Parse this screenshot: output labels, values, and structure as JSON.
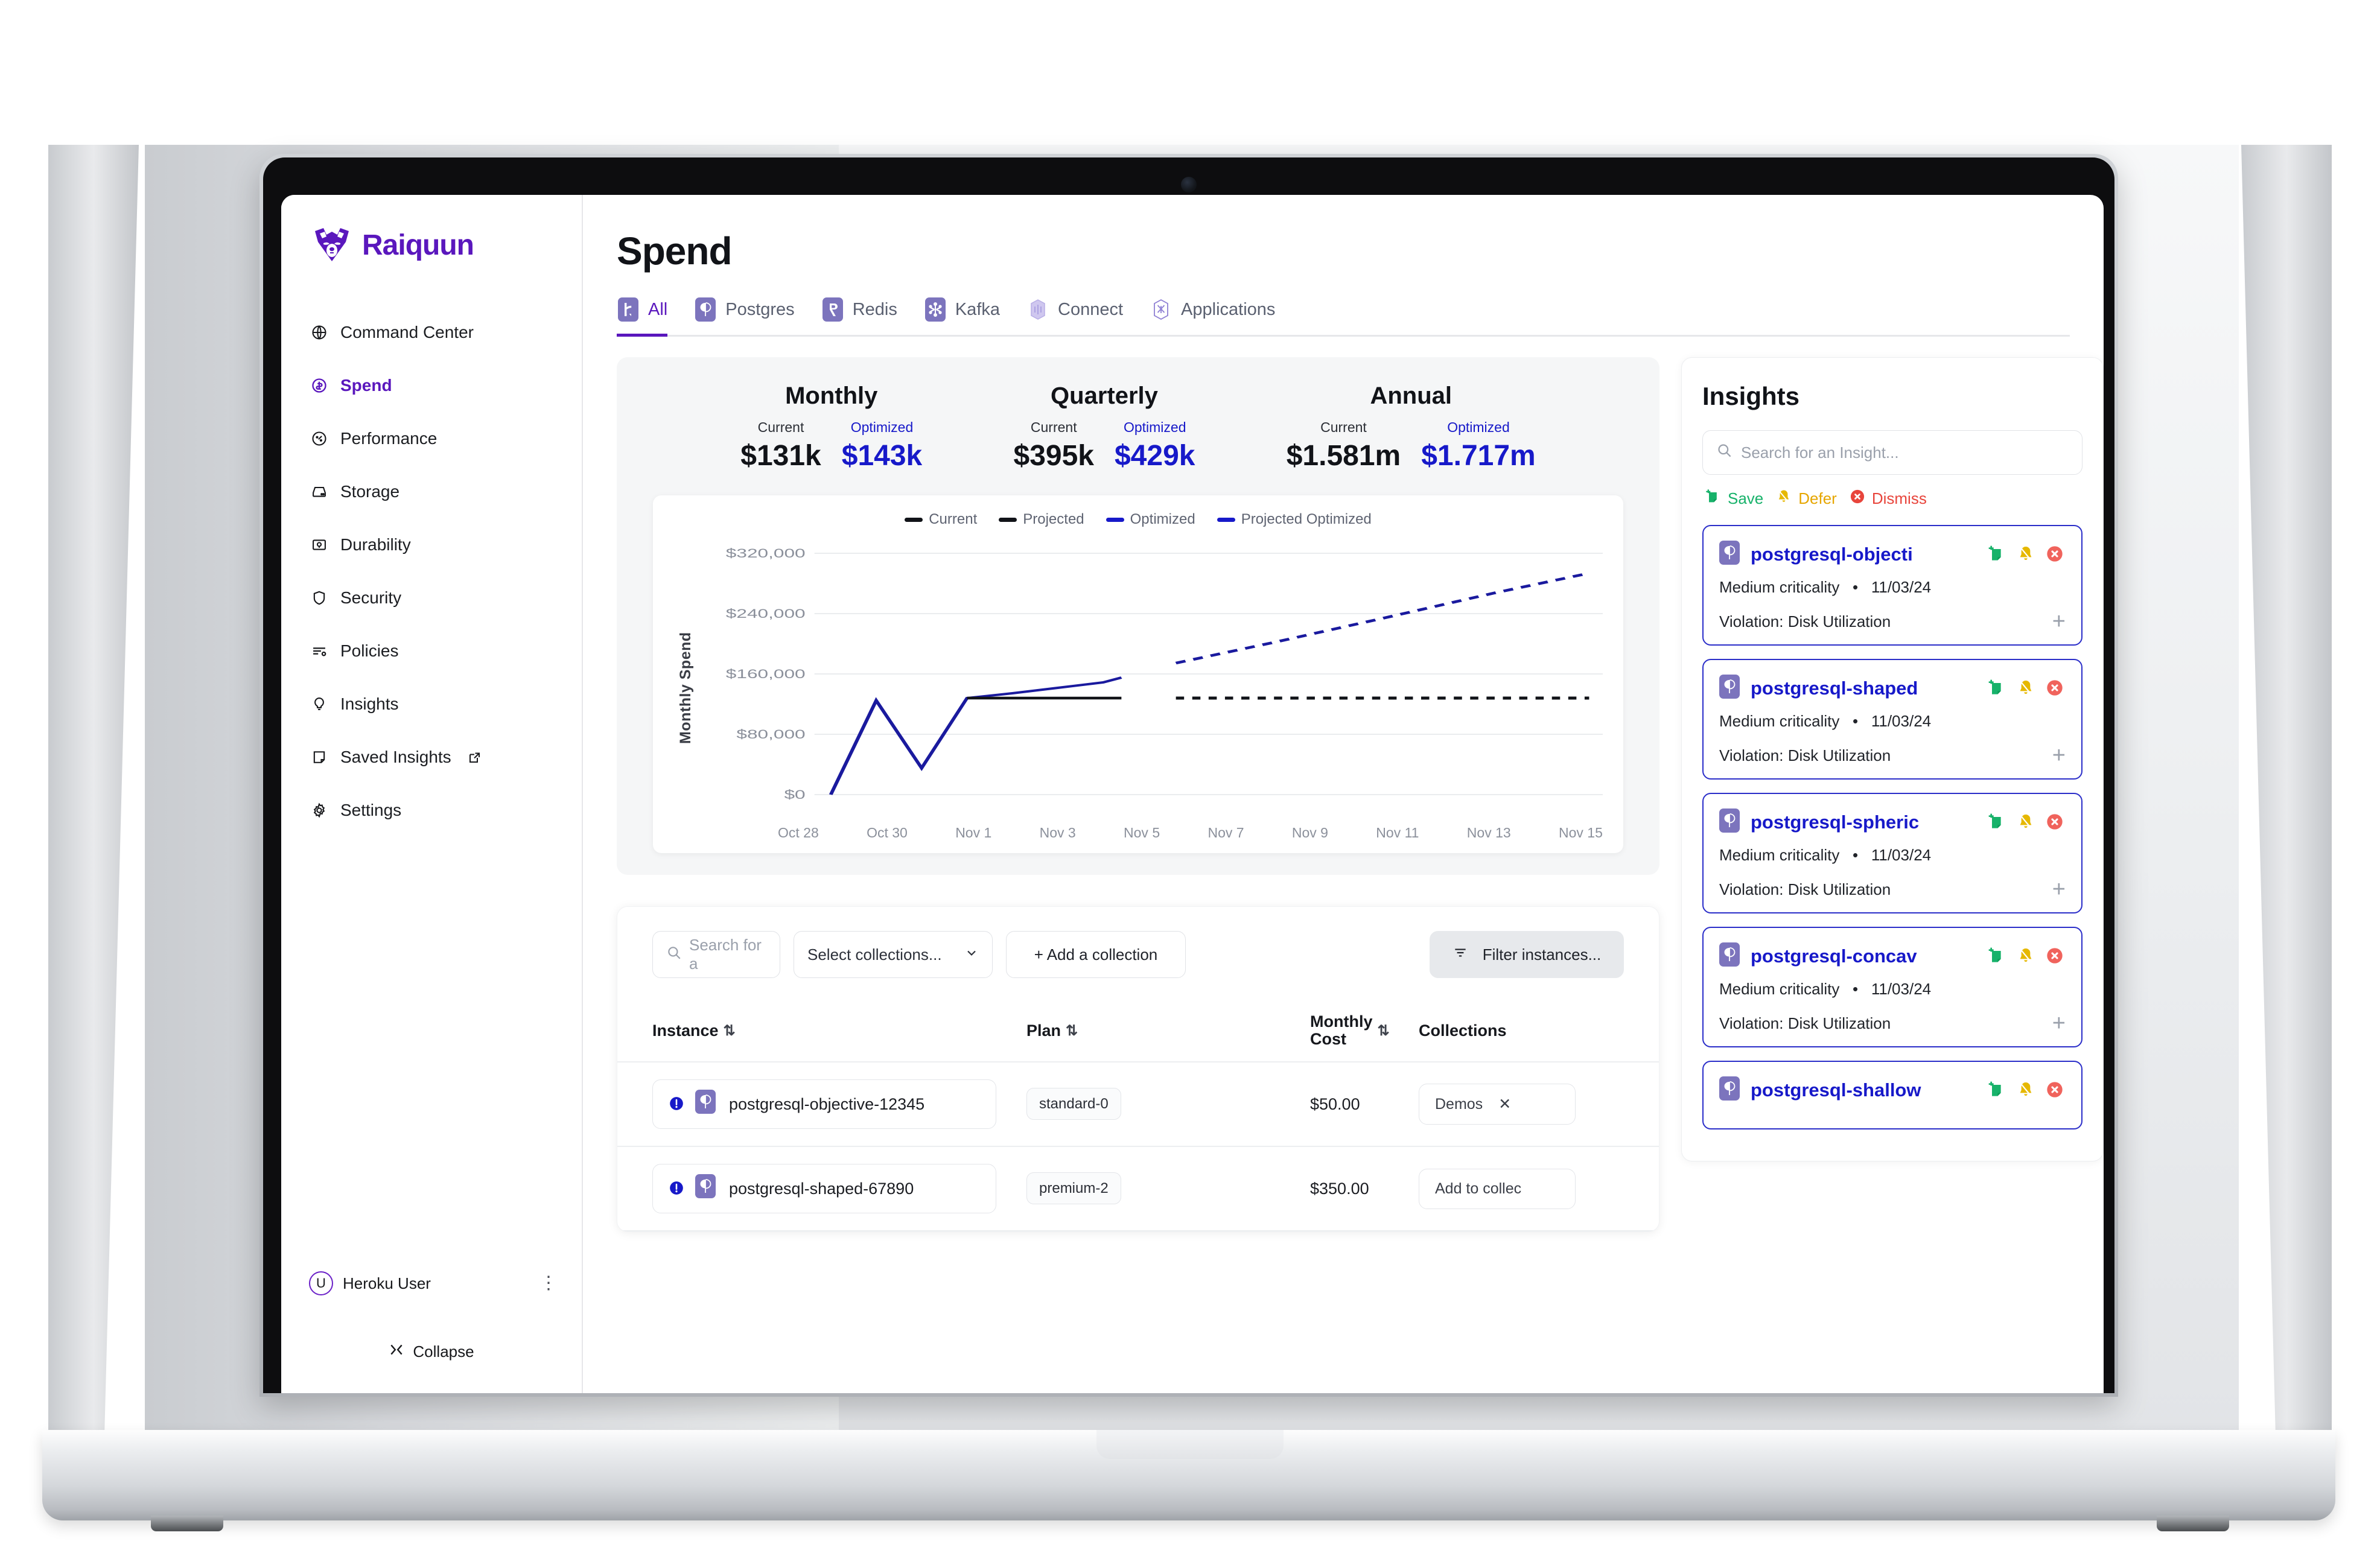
{
  "brand": {
    "name": "Raiquun"
  },
  "sidebar": {
    "items": [
      {
        "label": "Command Center",
        "icon": "globe-icon",
        "active": false
      },
      {
        "label": "Spend",
        "icon": "dollar-circle-icon",
        "active": true
      },
      {
        "label": "Performance",
        "icon": "gauge-icon",
        "active": false
      },
      {
        "label": "Storage",
        "icon": "drive-icon",
        "active": false
      },
      {
        "label": "Durability",
        "icon": "vault-icon",
        "active": false
      },
      {
        "label": "Security",
        "icon": "shield-icon",
        "active": false
      },
      {
        "label": "Policies",
        "icon": "sliders-icon",
        "active": false
      },
      {
        "label": "Insights",
        "icon": "lightbulb-icon",
        "active": false
      },
      {
        "label": "Saved Insights",
        "icon": "note-icon",
        "external": true,
        "active": false
      },
      {
        "label": "Settings",
        "icon": "gear-icon",
        "active": false
      }
    ],
    "user": {
      "initial": "U",
      "name": "Heroku User"
    },
    "collapse_label": "Collapse"
  },
  "header": {
    "title": "Spend"
  },
  "tabs": [
    {
      "label": "All",
      "icon": "heroku-icon",
      "active": true
    },
    {
      "label": "Postgres",
      "icon": "postgres-icon",
      "active": false
    },
    {
      "label": "Redis",
      "icon": "redis-icon",
      "active": false
    },
    {
      "label": "Kafka",
      "icon": "kafka-icon",
      "active": false
    },
    {
      "label": "Connect",
      "icon": "connect-icon",
      "active": false
    },
    {
      "label": "Applications",
      "icon": "applications-icon",
      "active": false
    }
  ],
  "spend_summary": {
    "current_label": "Current",
    "optimized_label": "Optimized",
    "metrics": [
      {
        "title": "Monthly",
        "current": "$131k",
        "optimized": "$143k"
      },
      {
        "title": "Quarterly",
        "current": "$395k",
        "optimized": "$429k"
      },
      {
        "title": "Annual",
        "current": "$1.581m",
        "optimized": "$1.717m"
      }
    ]
  },
  "chart_data": {
    "type": "line",
    "title": "",
    "xlabel": "",
    "ylabel": "Monthly Spend",
    "grid": true,
    "legend_position": "top",
    "legend": [
      "Current",
      "Projected",
      "Optimized",
      "Projected Optimized"
    ],
    "colors": {
      "current": "#111318",
      "projected": "#111318",
      "optimized": "#1719c9",
      "projected_optimized": "#1719c9"
    },
    "x": [
      "Oct 28",
      "Oct 29",
      "Oct 30",
      "Oct 31",
      "Nov 1",
      "Nov 2",
      "Nov 3",
      "Nov 4",
      "Nov 5",
      "Nov 6",
      "Nov 7",
      "Nov 8",
      "Nov 9",
      "Nov 10",
      "Nov 11",
      "Nov 12",
      "Nov 13",
      "Nov 14",
      "Nov 15"
    ],
    "xticks": [
      "Oct 28",
      "Oct 30",
      "Nov 1",
      "Nov 3",
      "Nov 5",
      "Nov 7",
      "Nov 9",
      "Nov 11",
      "Nov 13",
      "Nov 15"
    ],
    "yticks": [
      "$0",
      "$80,000",
      "$160,000",
      "$240,000",
      "$320,000"
    ],
    "ylim": [
      0,
      340000
    ],
    "series": [
      {
        "name": "Optimized",
        "style": "solid",
        "color": "#1719c9",
        "x": [
          "Oct 28",
          "Oct 29",
          "Oct 30",
          "Oct 31",
          "Nov 1",
          "Nov 2",
          "Nov 3",
          "Nov 4"
        ],
        "values": [
          0,
          125000,
          35000,
          128000,
          140000,
          152000,
          165000,
          178000
        ]
      },
      {
        "name": "Current",
        "style": "solid",
        "color": "#111318",
        "x": [
          "Oct 31",
          "Nov 1",
          "Nov 2",
          "Nov 3",
          "Nov 4"
        ],
        "values": [
          128000,
          128000,
          128000,
          128000,
          128000
        ]
      },
      {
        "name": "Projected Optimized",
        "style": "dashed",
        "color": "#1719c9",
        "x": [
          "Nov 5",
          "Nov 7",
          "Nov 9",
          "Nov 11",
          "Nov 13",
          "Nov 15"
        ],
        "values": [
          190000,
          212000,
          238000,
          265000,
          288000,
          308000
        ]
      },
      {
        "name": "Projected",
        "style": "dotted",
        "color": "#111318",
        "x": [
          "Nov 5",
          "Nov 7",
          "Nov 9",
          "Nov 11",
          "Nov 13",
          "Nov 15"
        ],
        "values": [
          128000,
          128000,
          128000,
          128000,
          128000,
          128000
        ]
      }
    ]
  },
  "instances_table": {
    "toolbar": {
      "search_placeholder": "Search for a",
      "collections_label": "Select collections...",
      "add_collection_label": "+ Add a collection",
      "filter_label": "Filter instances..."
    },
    "columns": [
      {
        "key": "instance",
        "label": "Instance",
        "sortable": true
      },
      {
        "key": "plan",
        "label": "Plan",
        "sortable": true
      },
      {
        "key": "cost_line1",
        "label": "Monthly",
        "cost_line2": "Cost",
        "sortable": true
      },
      {
        "key": "collections",
        "label": "Collections",
        "sortable": false
      }
    ],
    "rows": [
      {
        "instance": "postgresql-objective-12345",
        "plan": "standard-0",
        "cost": "$50.00",
        "collection": "Demos",
        "collection_removable": true
      },
      {
        "instance": "postgresql-shaped-67890",
        "plan": "premium-2",
        "cost": "$350.00",
        "collection": "Add to collec",
        "collection_removable": false
      }
    ]
  },
  "insights": {
    "title": "Insights",
    "search_placeholder": "Search for an Insight...",
    "actions": [
      {
        "label": "Save",
        "icon": "save-note-icon",
        "color": "#17b26a"
      },
      {
        "label": "Defer",
        "icon": "bell-off-icon",
        "color": "#e6a600"
      },
      {
        "label": "Dismiss",
        "icon": "dismiss-x-icon",
        "color": "#e8453c"
      }
    ],
    "cards": [
      {
        "name": "postgresql-objecti",
        "criticality": "Medium criticality",
        "date": "11/03/24",
        "violation": "Violation: Disk Utilization"
      },
      {
        "name": "postgresql-shaped",
        "criticality": "Medium criticality",
        "date": "11/03/24",
        "violation": "Violation: Disk Utilization"
      },
      {
        "name": "postgresql-spheric",
        "criticality": "Medium criticality",
        "date": "11/03/24",
        "violation": "Violation: Disk Utilization"
      },
      {
        "name": "postgresql-concav",
        "criticality": "Medium criticality",
        "date": "11/03/24",
        "violation": "Violation: Disk Utilization"
      },
      {
        "name": "postgresql-shallow",
        "criticality": "",
        "date": "",
        "violation": ""
      }
    ]
  }
}
